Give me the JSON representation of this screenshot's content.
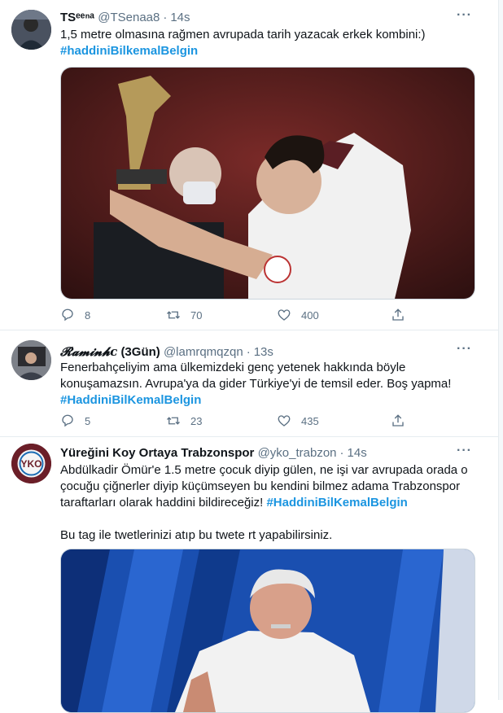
{
  "tweets": [
    {
      "name": "TSᵉᵉⁿᵃ",
      "handle": "@TSenaa8",
      "time": "14s",
      "text_lines": [
        "1,5 metre olmasına rağmen avrupada tarih yazacak erkek kombini:)"
      ],
      "hashtag": "#haddiniBilkemalBelgin",
      "reply_count": "8",
      "retweet_count": "70",
      "like_count": "400"
    },
    {
      "name": "𝓡𝓪𝓶𝓲𝓷𝓱ᴄ",
      "name_suffix": "(3Gün)",
      "handle": "@lamrqmqzqn",
      "time": "13s",
      "text_lines": [
        "Fenerbahçeliyim ama ülkemizdeki genç yetenek hakkında böyle",
        "konuşamazsın. Avrupa'ya da gider Türkiye'yi de temsil eder. Boş yapma!"
      ],
      "hashtag": "#HaddiniBilKemalBelgin",
      "reply_count": "5",
      "retweet_count": "23",
      "like_count": "435"
    },
    {
      "name": "Yüreğini Koy Ortaya Trabzonspor",
      "handle": "@yko_trabzon",
      "time": "14s",
      "text_lines": [
        "Abdülkadir Ömür'e 1.5 metre çocuk diyip gülen, ne işi var avrupada orada o",
        "çocuğu çiğnerler diyip küçümseyen bu kendini bilmez adama Trabzonspor",
        "taraftarları olarak haddini bildireceğiz!"
      ],
      "hashtag": "#HaddiniBilKemalBelgin",
      "extra_text": "Bu tag ile twetlerinizi atıp bu twete rt yapabilirsiniz.",
      "avatar_text": "YKO"
    }
  ],
  "more_label": "···",
  "colors": {
    "link": "#1b95e0",
    "muted": "#5b7083",
    "border": "#e6ecf0"
  }
}
